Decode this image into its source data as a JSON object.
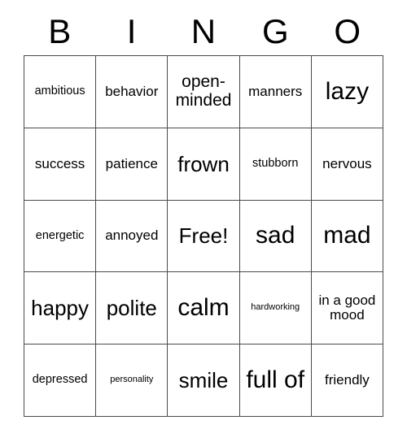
{
  "card": {
    "title": "BINGO",
    "header_letters": [
      "B",
      "I",
      "N",
      "G",
      "O"
    ],
    "border_color": "#4a4a4a",
    "text_color": "#000000",
    "background_color": "#ffffff",
    "columns": 5,
    "rows": 5,
    "free_space": "Free!",
    "free_space_position": {
      "row": 3,
      "column": 3
    },
    "cells": [
      [
        {
          "text": "ambitious",
          "size": "sm"
        },
        {
          "text": "behavior",
          "size": "md"
        },
        {
          "text": "open-minded",
          "size": "lg"
        },
        {
          "text": "manners",
          "size": "md"
        },
        {
          "text": "lazy",
          "size": "xxl"
        }
      ],
      [
        {
          "text": "success",
          "size": "md"
        },
        {
          "text": "patience",
          "size": "md"
        },
        {
          "text": "frown",
          "size": "xl"
        },
        {
          "text": "stubborn",
          "size": "sm"
        },
        {
          "text": "nervous",
          "size": "md"
        }
      ],
      [
        {
          "text": "energetic",
          "size": "sm"
        },
        {
          "text": "annoyed",
          "size": "md"
        },
        {
          "text": "Free!",
          "size": "xl"
        },
        {
          "text": "sad",
          "size": "xxl"
        },
        {
          "text": "mad",
          "size": "xxl"
        }
      ],
      [
        {
          "text": "happy",
          "size": "xl"
        },
        {
          "text": "polite",
          "size": "xl"
        },
        {
          "text": "calm",
          "size": "xxl"
        },
        {
          "text": "hardworking",
          "size": "xs"
        },
        {
          "text": "in a good mood",
          "size": "md"
        }
      ],
      [
        {
          "text": "depressed",
          "size": "sm"
        },
        {
          "text": "personality",
          "size": "xs"
        },
        {
          "text": "smile",
          "size": "xl"
        },
        {
          "text": "full of",
          "size": "xxl"
        },
        {
          "text": "friendly",
          "size": "md"
        }
      ]
    ]
  }
}
